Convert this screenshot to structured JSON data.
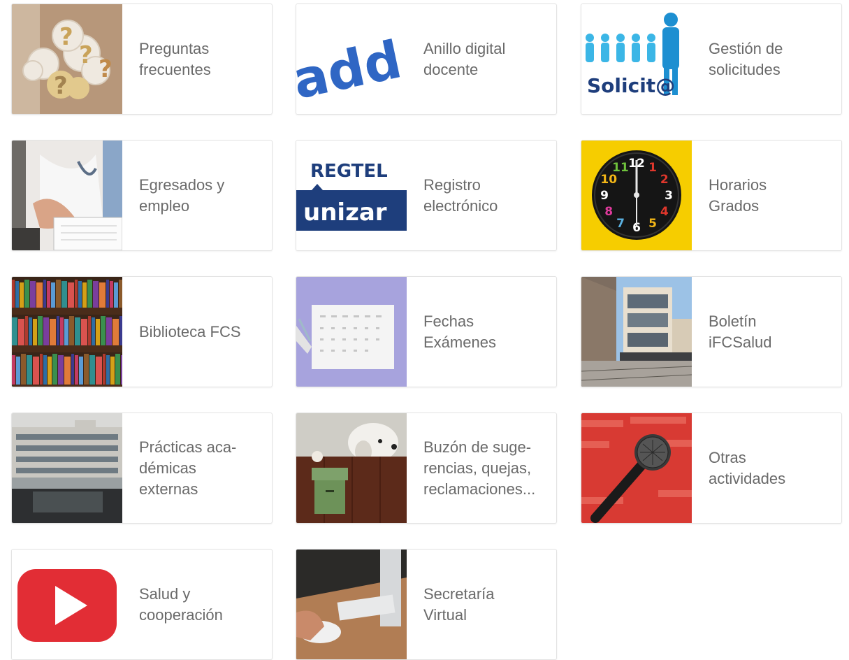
{
  "tiles": [
    {
      "label": "Preguntas\nfrecuentes",
      "icon": "question-marks-image"
    },
    {
      "label": "Anillo digital\ndocente",
      "icon": "add-logo",
      "logo_text": "add"
    },
    {
      "label": "Gestión de\nsolicitudes",
      "icon": "solicita-logo",
      "logo_text": "Solicit@"
    },
    {
      "label": "Egresados y\nempleo",
      "icon": "doctor-image"
    },
    {
      "label": "Registro\nelectrónico",
      "icon": "regtel-logo",
      "logo_top": "REGTEL",
      "logo_bottom": "unizar"
    },
    {
      "label": "Horarios\nGrados",
      "icon": "clock-image"
    },
    {
      "label": "Biblioteca FCS",
      "icon": "bookshelf-image"
    },
    {
      "label": "Fechas\nExámenes",
      "icon": "calendar-image"
    },
    {
      "label": "Boletín\niFCSalud",
      "icon": "building-image"
    },
    {
      "label": "Prácticas aca-\ndémicas\nexternas",
      "icon": "hospital-image"
    },
    {
      "label": "Buzón de suge-\nrencias, quejas,\nreclamaciones...",
      "icon": "dog-mailbox-image"
    },
    {
      "label": "Otras\nactividades",
      "icon": "microphone-image"
    },
    {
      "label": "Salud y\ncooperación",
      "icon": "youtube-icon"
    },
    {
      "label": "Secretaría\nVirtual",
      "icon": "computer-mouse-image"
    }
  ],
  "clock_numbers": [
    "12",
    "1",
    "2",
    "3",
    "4",
    "5",
    "6",
    "7",
    "8",
    "9",
    "10",
    "11"
  ]
}
